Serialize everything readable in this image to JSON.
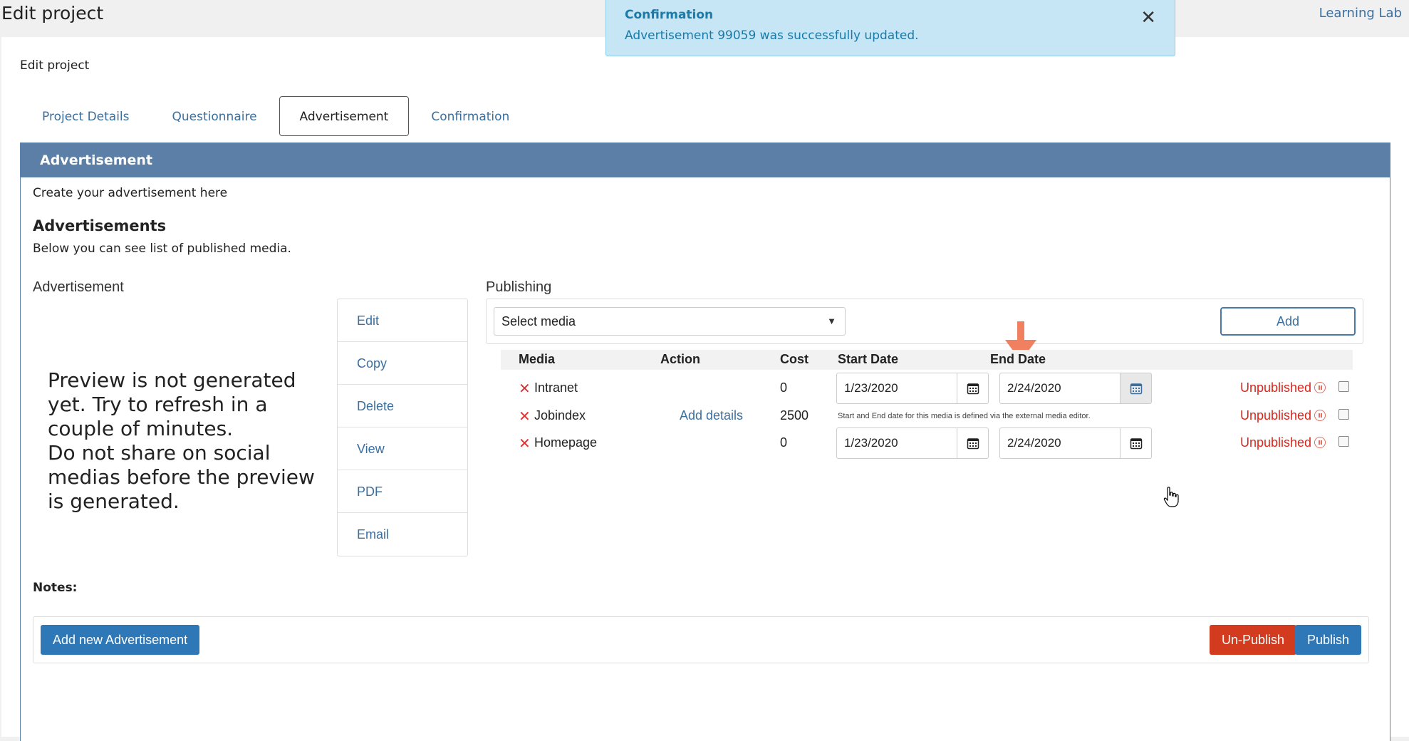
{
  "header": {
    "title": "Edit project",
    "brand": "Learning Lab"
  },
  "toast": {
    "title": "Confirmation",
    "message": "Advertisement 99059 was successfully updated.",
    "close_icon": "close-icon"
  },
  "breadcrumb": "Edit project",
  "tabs": [
    {
      "label": "Project Details",
      "active": false
    },
    {
      "label": "Questionnaire",
      "active": false
    },
    {
      "label": "Advertisement",
      "active": true
    },
    {
      "label": "Confirmation",
      "active": false
    }
  ],
  "panel": {
    "title": "Advertisement",
    "intro": "Create your advertisement here",
    "section_title": "Advertisements",
    "section_desc": "Below you can see list of published media.",
    "left_label": "Advertisement",
    "preview_text": "Preview is not generated yet. Try to refresh in a couple of minutes.\nDo not share on social medias before the preview is generated.",
    "actions": [
      "Edit",
      "Copy",
      "Delete",
      "View",
      "PDF",
      "Email"
    ],
    "notes_label": "Notes:"
  },
  "publishing": {
    "label": "Publishing",
    "select_value": "Select media",
    "add_label": "Add",
    "columns": [
      "Media",
      "Action",
      "Cost",
      "Start Date",
      "End Date"
    ],
    "rows": [
      {
        "media": "Intranet",
        "action": "",
        "cost": "0",
        "start": "1/23/2020",
        "end": "2/24/2020",
        "status": "Unpublished"
      },
      {
        "media": "Jobindex",
        "action": "Add details",
        "cost": "2500",
        "note": "Start and End date for this media is defined via the external media editor.",
        "status": "Unpublished"
      },
      {
        "media": "Homepage",
        "action": "",
        "cost": "0",
        "start": "1/23/2020",
        "end": "2/24/2020",
        "status": "Unpublished"
      }
    ]
  },
  "footer": {
    "add_new_label": "Add new Advertisement",
    "unpublish_label": "Un-Publish",
    "publish_label": "Publish"
  },
  "colors": {
    "panel_header": "#5b7fa6",
    "link": "#3a6fa0",
    "status_red": "#d9261c",
    "primary": "#2e78b8",
    "danger": "#d33b1f",
    "toast_bg": "#c6e6f6"
  }
}
